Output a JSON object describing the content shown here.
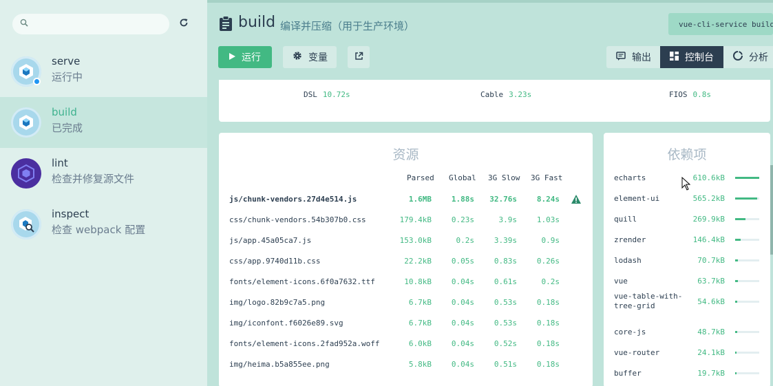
{
  "sidebar": {
    "tasks": [
      {
        "name": "serve",
        "desc": "运行中"
      },
      {
        "name": "build",
        "desc": "已完成"
      },
      {
        "name": "lint",
        "desc": "检查并修复源文件"
      },
      {
        "name": "inspect",
        "desc": "检查 webpack 配置"
      }
    ]
  },
  "header": {
    "title": "build",
    "subtitle": "编译并压缩（用于生产环境）",
    "command": "vue-cli-service build"
  },
  "toolbar": {
    "run": "运行",
    "vars": "变量",
    "output": "输出",
    "dashboard": "控制台",
    "analyzer": "分析"
  },
  "speed": [
    {
      "label": "DSL",
      "value": "10.72s"
    },
    {
      "label": "Cable",
      "value": "3.23s"
    },
    {
      "label": "FIOS",
      "value": "0.8s"
    }
  ],
  "assets": {
    "title": "资源",
    "columns": [
      "Parsed",
      "Global",
      "3G Slow",
      "3G Fast"
    ],
    "rows": [
      {
        "file": "js/chunk-vendors.27d4e514.js",
        "parsed": "1.6MB",
        "global": "1.88s",
        "slow": "32.76s",
        "fast": "8.24s"
      },
      {
        "file": "css/chunk-vendors.54b307b0.css",
        "parsed": "179.4kB",
        "global": "0.23s",
        "slow": "3.9s",
        "fast": "1.03s"
      },
      {
        "file": "js/app.45a05ca7.js",
        "parsed": "153.0kB",
        "global": "0.2s",
        "slow": "3.39s",
        "fast": "0.9s"
      },
      {
        "file": "css/app.9740d11b.css",
        "parsed": "22.2kB",
        "global": "0.05s",
        "slow": "0.83s",
        "fast": "0.26s"
      },
      {
        "file": "fonts/element-icons.6f0a7632.ttf",
        "parsed": "10.8kB",
        "global": "0.04s",
        "slow": "0.61s",
        "fast": "0.2s"
      },
      {
        "file": "img/logo.82b9c7a5.png",
        "parsed": "6.7kB",
        "global": "0.04s",
        "slow": "0.53s",
        "fast": "0.18s"
      },
      {
        "file": "img/iconfont.f6026e89.svg",
        "parsed": "6.7kB",
        "global": "0.04s",
        "slow": "0.53s",
        "fast": "0.18s"
      },
      {
        "file": "fonts/element-icons.2fad952a.woff",
        "parsed": "6.0kB",
        "global": "0.04s",
        "slow": "0.52s",
        "fast": "0.18s"
      },
      {
        "file": "img/heima.b5a855ee.png",
        "parsed": "5.8kB",
        "global": "0.04s",
        "slow": "0.51s",
        "fast": "0.18s"
      }
    ]
  },
  "deps": {
    "title": "依赖项",
    "rows": [
      {
        "name": "echarts",
        "size": "610.6kB",
        "ratio": 1.0
      },
      {
        "name": "element-ui",
        "size": "565.2kB",
        "ratio": 0.92
      },
      {
        "name": "quill",
        "size": "269.9kB",
        "ratio": 0.44
      },
      {
        "name": "zrender",
        "size": "146.4kB",
        "ratio": 0.24
      },
      {
        "name": "lodash",
        "size": "70.7kB",
        "ratio": 0.12
      },
      {
        "name": "vue",
        "size": "63.7kB",
        "ratio": 0.1
      },
      {
        "name": "vue-table-with-tree-grid",
        "size": "54.6kB",
        "ratio": 0.09
      },
      {
        "name": "core-js",
        "size": "48.7kB",
        "ratio": 0.08
      },
      {
        "name": "vue-router",
        "size": "24.1kB",
        "ratio": 0.04
      },
      {
        "name": "buffer",
        "size": "19.7kB",
        "ratio": 0.03
      }
    ]
  },
  "colors": {
    "accent": "#42b983",
    "dark": "#2c3e50"
  }
}
